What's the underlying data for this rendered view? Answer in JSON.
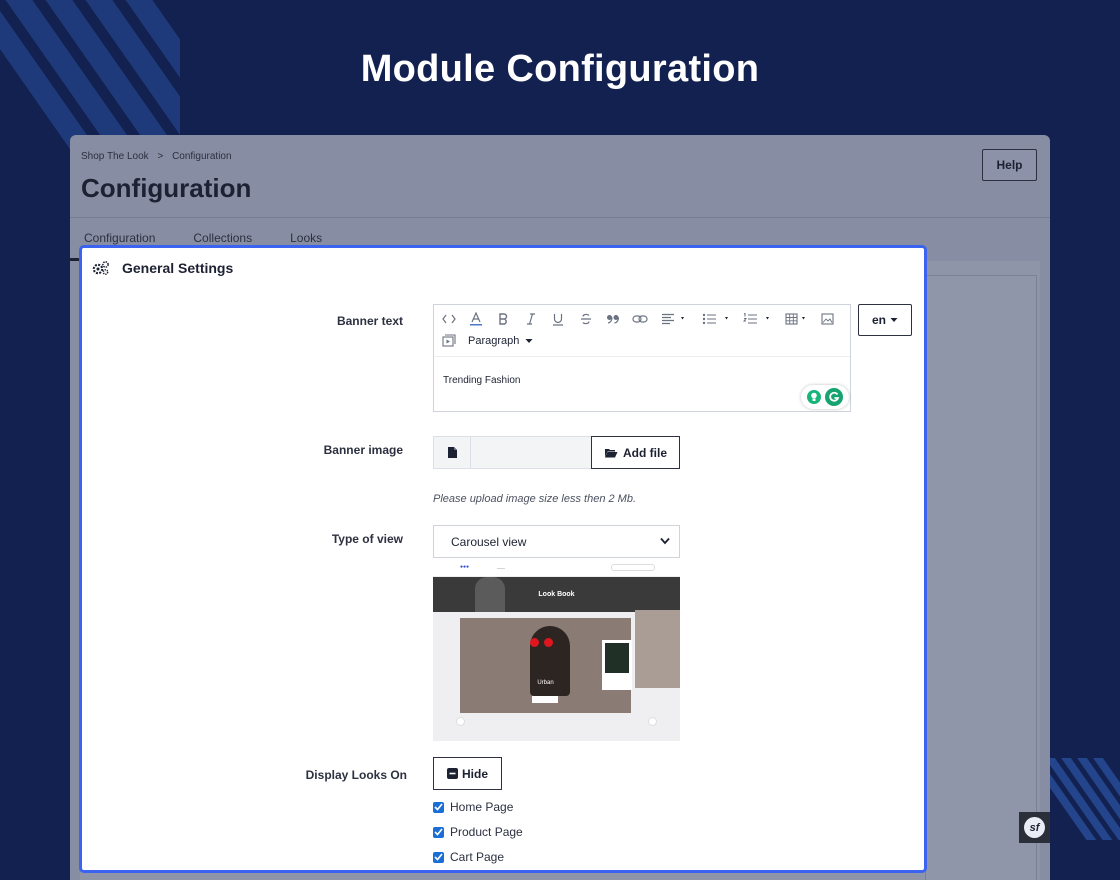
{
  "hero": {
    "title": "Module Configuration"
  },
  "admin": {
    "breadcrumb": [
      "Shop The Look",
      "Configuration"
    ],
    "breadcrumb_separator": ">",
    "title": "Configuration",
    "help_label": "Help",
    "tabs": [
      {
        "label": "Configuration",
        "active": true
      },
      {
        "label": "Collections",
        "active": false
      },
      {
        "label": "Looks",
        "active": false
      }
    ]
  },
  "panel": {
    "title": "General Settings",
    "banner_text": {
      "label": "Banner text",
      "format_select": "Paragraph",
      "content": "Trending Fashion",
      "language": "en"
    },
    "banner_image": {
      "label": "Banner image",
      "add_file_label": "Add file",
      "hint": "Please upload image size less then 2 Mb."
    },
    "type_of_view": {
      "label": "Type of view",
      "selected": "Carousel view",
      "preview": {
        "banner_title": "Look Book",
        "card_caption": "Urban"
      }
    },
    "display_looks_on": {
      "label": "Display Looks On",
      "toggle_label": "Hide",
      "options": [
        {
          "label": "Home Page",
          "checked": true
        },
        {
          "label": "Product Page",
          "checked": true
        },
        {
          "label": "Cart Page",
          "checked": true
        }
      ]
    }
  },
  "colors": {
    "hero_bg": "#12214f",
    "panel_border": "#3b63f0",
    "checkbox": "#1a6fd6"
  },
  "badge": {
    "icon": "symfony-icon"
  }
}
